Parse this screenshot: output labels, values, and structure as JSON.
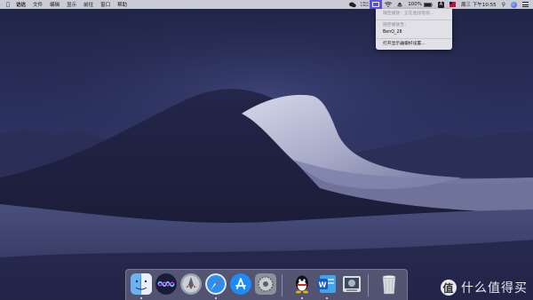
{
  "menubar": {
    "apple_icon": "apple-icon",
    "items": [
      "访达",
      "文件",
      "编辑",
      "显示",
      "前往",
      "窗口",
      "帮助"
    ],
    "right": {
      "wechat_icon": "wechat-icon",
      "tray_text_1": [
        "1.5K/s",
        "0.5K/s"
      ],
      "airplay_display_icon": "airplay-display-icon",
      "wifi_icon": "wifi-icon",
      "eject_icon": "eject-icon",
      "battery": "100%",
      "input_method": "A",
      "flag_icon": "flag-icon",
      "clock": "周三 下午10:55",
      "spotlight_icon": "spotlight-icon",
      "siri_icon": "siri-icon",
      "notification_icon": "notification-center-icon"
    }
  },
  "airplay_menu": {
    "header_status": "隔空播放：正在查找电视...",
    "section_label": "隔空播放至：",
    "device": "BenQ_28",
    "preferences": "打开显示器偏好设置..."
  },
  "dock": {
    "apps": [
      {
        "name": "finder",
        "icon": "finder-icon",
        "running": true
      },
      {
        "name": "siri",
        "icon": "siri-icon",
        "running": false
      },
      {
        "name": "launchpad",
        "icon": "launchpad-icon",
        "running": false
      },
      {
        "name": "safari",
        "icon": "safari-icon",
        "running": true
      },
      {
        "name": "app-store",
        "icon": "app-store-icon",
        "running": false
      },
      {
        "name": "system-preferences",
        "icon": "system-preferences-icon",
        "running": false
      },
      {
        "name": "qq",
        "icon": "qq-icon",
        "running": true
      },
      {
        "name": "word",
        "icon": "word-icon",
        "running": true
      },
      {
        "name": "preview",
        "icon": "preview-icon",
        "running": false
      },
      {
        "name": "trash",
        "icon": "trash-icon",
        "running": false
      }
    ]
  },
  "watermark": {
    "text": "什么值得买",
    "logo_char": "值"
  },
  "colors": {
    "accent": "#5b54d6",
    "sky_top": "#2a2f55",
    "dune_light": "#c9cbe0",
    "dune_shadow": "#1a1c35"
  }
}
